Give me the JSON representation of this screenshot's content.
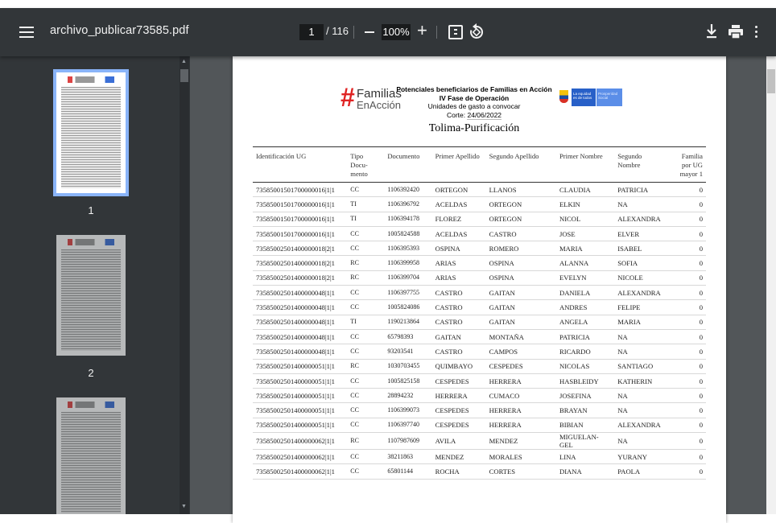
{
  "toolbar": {
    "file_name": "archivo_publicar73585.pdf",
    "current_page": "1",
    "total_pages": "/ 116",
    "zoom": "100%",
    "zoom_minus": "−",
    "zoom_plus": "+"
  },
  "sidebar": {
    "thumbnails": [
      {
        "label": "1",
        "active": true
      },
      {
        "label": "2",
        "active": false
      },
      {
        "label": "",
        "active": false
      }
    ]
  },
  "document": {
    "logo_familias_line1": "Familias",
    "logo_familias_line2": "EnAcción",
    "header_line1": "Potenciales beneficiarios de Familias en Acción",
    "header_line2": "IV Fase de Operación",
    "header_line3": "Unidades de gasto a convocar",
    "header_corte_label": "Corte:",
    "header_corte_date": "24/06/2022",
    "header_city": "Tolima-Purificación",
    "logo_equidad_text": "La equidad es de todos",
    "logo_prosperidad_text": "Prosperidad Social",
    "table": {
      "columns": [
        "Identificación UG",
        "Tipo Docu- mento",
        "Documento",
        "Primer Apellido",
        "Segundo Apellido",
        "Primer Nombre",
        "Segundo Nombre",
        "Familia por UG mayor 1"
      ],
      "rows": [
        [
          "73585001501700000016|1|1",
          "CC",
          "1106392420",
          "ORTEGON",
          "LLANOS",
          "CLAUDIA",
          "PATRICIA",
          "0"
        ],
        [
          "73585001501700000016|1|1",
          "TI",
          "1106396792",
          "ACELDAS",
          "ORTEGON",
          "ELKIN",
          "NA",
          "0"
        ],
        [
          "73585001501700000016|1|1",
          "TI",
          "1106394178",
          "FLOREZ",
          "ORTEGON",
          "NICOL",
          "ALEXANDRA",
          "0"
        ],
        [
          "73585001501700000016|1|1",
          "CC",
          "1005824588",
          "ACELDAS",
          "CASTRO",
          "JOSE",
          "ELVER",
          "0"
        ],
        [
          "73585002501400000018|2|1",
          "CC",
          "1106395393",
          "OSPINA",
          "ROMERO",
          "MARIA",
          "ISABEL",
          "0"
        ],
        [
          "73585002501400000018|2|1",
          "RC",
          "1106399958",
          "ARIAS",
          "OSPINA",
          "ALANNA",
          "SOFIA",
          "0"
        ],
        [
          "73585002501400000018|2|1",
          "RC",
          "1106399704",
          "ARIAS",
          "OSPINA",
          "EVELYN",
          "NICOLE",
          "0"
        ],
        [
          "73585002501400000048|1|1",
          "CC",
          "1106397755",
          "CASTRO",
          "GAITAN",
          "DANIELA",
          "ALEXANDRA",
          "0"
        ],
        [
          "73585002501400000048|1|1",
          "CC",
          "1005824086",
          "CASTRO",
          "GAITAN",
          "ANDRES",
          "FELIPE",
          "0"
        ],
        [
          "73585002501400000048|1|1",
          "TI",
          "1190213864",
          "CASTRO",
          "GAITAN",
          "ANGELA",
          "MARIA",
          "0"
        ],
        [
          "73585002501400000048|1|1",
          "CC",
          "65798393",
          "GAITAN",
          "MONTAÑA",
          "PATRICIA",
          "NA",
          "0"
        ],
        [
          "73585002501400000048|1|1",
          "CC",
          "93203541",
          "CASTRO",
          "CAMPOS",
          "RICARDO",
          "NA",
          "0"
        ],
        [
          "73585002501400000051|1|1",
          "RC",
          "1030703455",
          "QUIMBAYO",
          "CESPEDES",
          "NICOLAS",
          "SANTIAGO",
          "0"
        ],
        [
          "73585002501400000051|1|1",
          "CC",
          "1005825158",
          "CESPEDES",
          "HERRERA",
          "HASBLEIDY",
          "KATHERIN",
          "0"
        ],
        [
          "73585002501400000051|1|1",
          "CC",
          "28894232",
          "HERRERA",
          "CUMACO",
          "JOSEFINA",
          "NA",
          "0"
        ],
        [
          "73585002501400000051|1|1",
          "CC",
          "1106399073",
          "CESPEDES",
          "HERRERA",
          "BRAYAN",
          "NA",
          "0"
        ],
        [
          "73585002501400000051|1|1",
          "CC",
          "1106397740",
          "CESPEDES",
          "HERRERA",
          "BIBIAN",
          "ALEXANDRA",
          "0"
        ],
        [
          "73585002501400000062|1|1",
          "RC",
          "1107987609",
          "AVILA",
          "MENDEZ",
          "MIGUELAN-\nGEL",
          "NA",
          "0"
        ],
        [
          "73585002501400000062|1|1",
          "CC",
          "38211863",
          "MENDEZ",
          "MORALES",
          "LINA",
          "YURANY",
          "0"
        ],
        [
          "73585002501400000062|1|1",
          "CC",
          "65801144",
          "ROCHA",
          "CORTES",
          "DIANA",
          "PAOLA",
          "0"
        ]
      ]
    }
  },
  "colors": {
    "toolbar_bg": "#323639",
    "viewer_bg": "#525659",
    "thumb_active_outline": "#8ab4f8",
    "logo_red": "#e02424",
    "logo_blue": "#2860c8"
  }
}
